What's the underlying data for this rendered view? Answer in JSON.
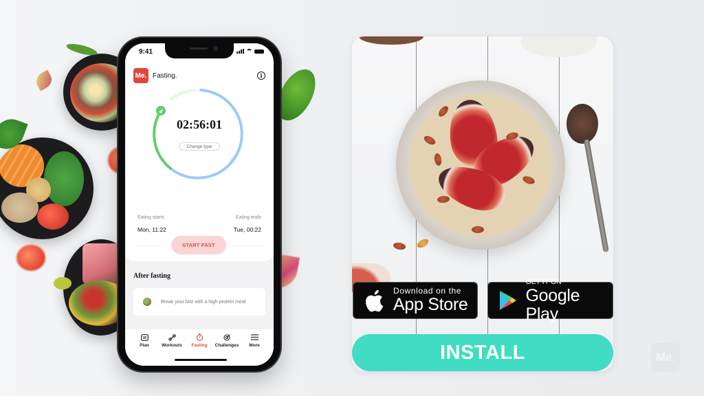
{
  "phone": {
    "status_bar": {
      "time": "9:41"
    },
    "app": {
      "logo_text": "Me.",
      "title": "Fasting.",
      "info_icon": "info-icon"
    },
    "timer": {
      "value": "02:56:01",
      "change_type_label": "Change type",
      "ring_label": "FAST"
    },
    "eating": {
      "starts_label": "Eating starts",
      "starts_value": "Mon, 11:22",
      "ends_label": "Eating ends",
      "ends_value": "Tue, 00:22"
    },
    "start_button_label": "START FAST",
    "after_fasting": {
      "title": "After fasting",
      "tip": "Break your fast with a high-protein meal"
    },
    "tabs": [
      {
        "label": "Plan",
        "icon": "plan-icon",
        "active": false
      },
      {
        "label": "Workouts",
        "icon": "dumbbell-icon",
        "active": false
      },
      {
        "label": "Fasting",
        "icon": "stopwatch-icon",
        "active": true
      },
      {
        "label": "Challenges",
        "icon": "target-icon",
        "active": false
      },
      {
        "label": "More",
        "icon": "menu-icon",
        "active": false
      }
    ]
  },
  "ad": {
    "app_store": {
      "small": "Download on the",
      "big": "App Store"
    },
    "google_play": {
      "small": "GET IT ON",
      "big": "Google Play"
    },
    "install_label": "INSTALL"
  },
  "corner_logo_text": "Me.",
  "colors": {
    "brand_red": "#e0463e",
    "ring_green": "#5fcf6e",
    "ring_blue": "#9ccbf3",
    "install_teal": "#40dcc3",
    "start_button_bg": "#f9d5d6"
  }
}
